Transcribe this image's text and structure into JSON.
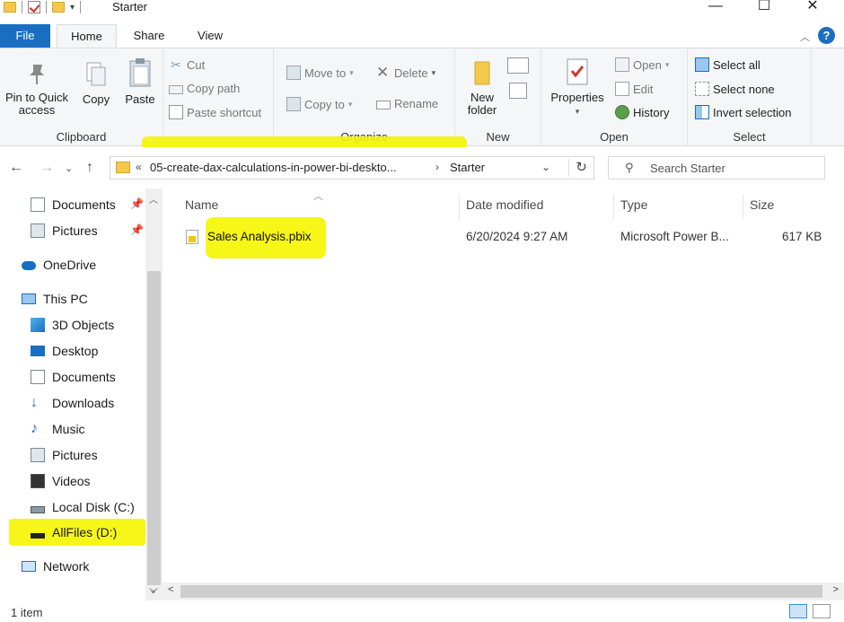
{
  "window": {
    "title": "Starter",
    "minimize_glyph": "—",
    "maximize_glyph": "☐",
    "close_glyph": "✕"
  },
  "ribbon_tabs": [
    {
      "label": "File"
    },
    {
      "label": "Home"
    },
    {
      "label": "Share"
    },
    {
      "label": "View"
    }
  ],
  "ribbon": {
    "clipboard": {
      "label": "Clipboard",
      "pin_to_quick_access": "Pin to Quick access",
      "copy": "Copy",
      "paste": "Paste",
      "cut": "Cut",
      "copy_path": "Copy path",
      "paste_shortcut": "Paste shortcut"
    },
    "organize": {
      "label": "Organize",
      "move_to": "Move to",
      "copy_to": "Copy to",
      "delete": "Delete",
      "rename": "Rename"
    },
    "new": {
      "label": "New",
      "new_folder": "New folder"
    },
    "open": {
      "label": "Open",
      "properties": "Properties",
      "open": "Open",
      "edit": "Edit",
      "history": "History"
    },
    "select": {
      "label": "Select",
      "select_all": "Select all",
      "select_none": "Select none",
      "invert_selection": "Invert selection"
    }
  },
  "address": {
    "overflow": "«",
    "segment_1": "05-create-dax-calculations-in-power-bi-deskto...",
    "separator": "›",
    "segment_2": "Starter"
  },
  "search": {
    "placeholder": "Search Starter"
  },
  "nav_pane": {
    "quick_access": [
      {
        "label": "Documents",
        "icon": "documents-icon",
        "pinned": true
      },
      {
        "label": "Pictures",
        "icon": "pictures-icon",
        "pinned": true
      }
    ],
    "onedrive": "OneDrive",
    "this_pc": "This PC",
    "this_pc_items": [
      {
        "label": "3D Objects",
        "icon": "3d-objects-icon"
      },
      {
        "label": "Desktop",
        "icon": "desktop-icon"
      },
      {
        "label": "Documents",
        "icon": "documents-icon"
      },
      {
        "label": "Downloads",
        "icon": "downloads-icon"
      },
      {
        "label": "Music",
        "icon": "music-icon"
      },
      {
        "label": "Pictures",
        "icon": "pictures-icon"
      },
      {
        "label": "Videos",
        "icon": "videos-icon"
      },
      {
        "label": "Local Disk (C:)",
        "icon": "local-disk-icon"
      },
      {
        "label": "AllFiles (D:)",
        "icon": "drive-icon"
      }
    ],
    "network": "Network"
  },
  "file_list": {
    "columns": [
      "Name",
      "Date modified",
      "Type",
      "Size"
    ],
    "rows": [
      {
        "name": "Sales Analysis.pbix",
        "date_modified": "6/20/2024 9:27 AM",
        "type": "Microsoft Power B...",
        "size": "617 KB"
      }
    ]
  },
  "status": {
    "item_count": "1 item"
  },
  "colors": {
    "accent": "#1a6ec2",
    "highlight": "#f5f500"
  }
}
